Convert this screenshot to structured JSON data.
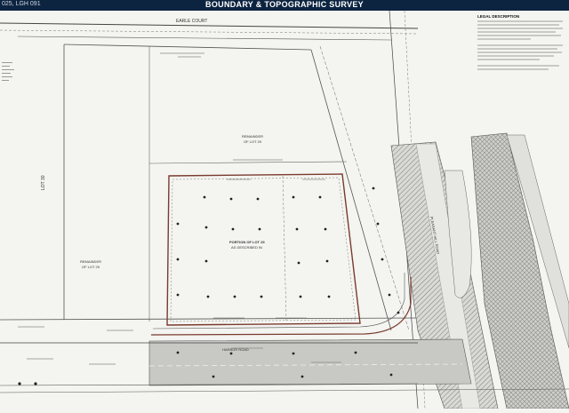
{
  "header": {
    "code": "025, LGH 091",
    "title": "BOUNDARY & TOPOGRAPHIC SURVEY"
  },
  "roads": {
    "top": "EARLE COURT",
    "bottom": "HARBOR ROAD",
    "right": "PLEASANT HILL ROAD"
  },
  "lots": {
    "lot_label": "LOT 30",
    "remainder_top": "REMAINDER",
    "remainder_top_sub": "OF LOT 29",
    "remainder_left": "REMAINDER",
    "remainder_left_sub": "OF LOT 29",
    "portion_line1": "PORTION OF LOT 29",
    "portion_line2": "AS DESCRIBED IN"
  },
  "legal": {
    "heading": "LEGAL DESCRIPTION"
  },
  "colors": {
    "header_bg": "#0d2440",
    "sheet_bg": "#f4f4f1",
    "road_fill": "#c8c8c4",
    "pavement_hatch": "#7a7a76",
    "boundary": "#7a3b2e",
    "ink": "#333333"
  }
}
